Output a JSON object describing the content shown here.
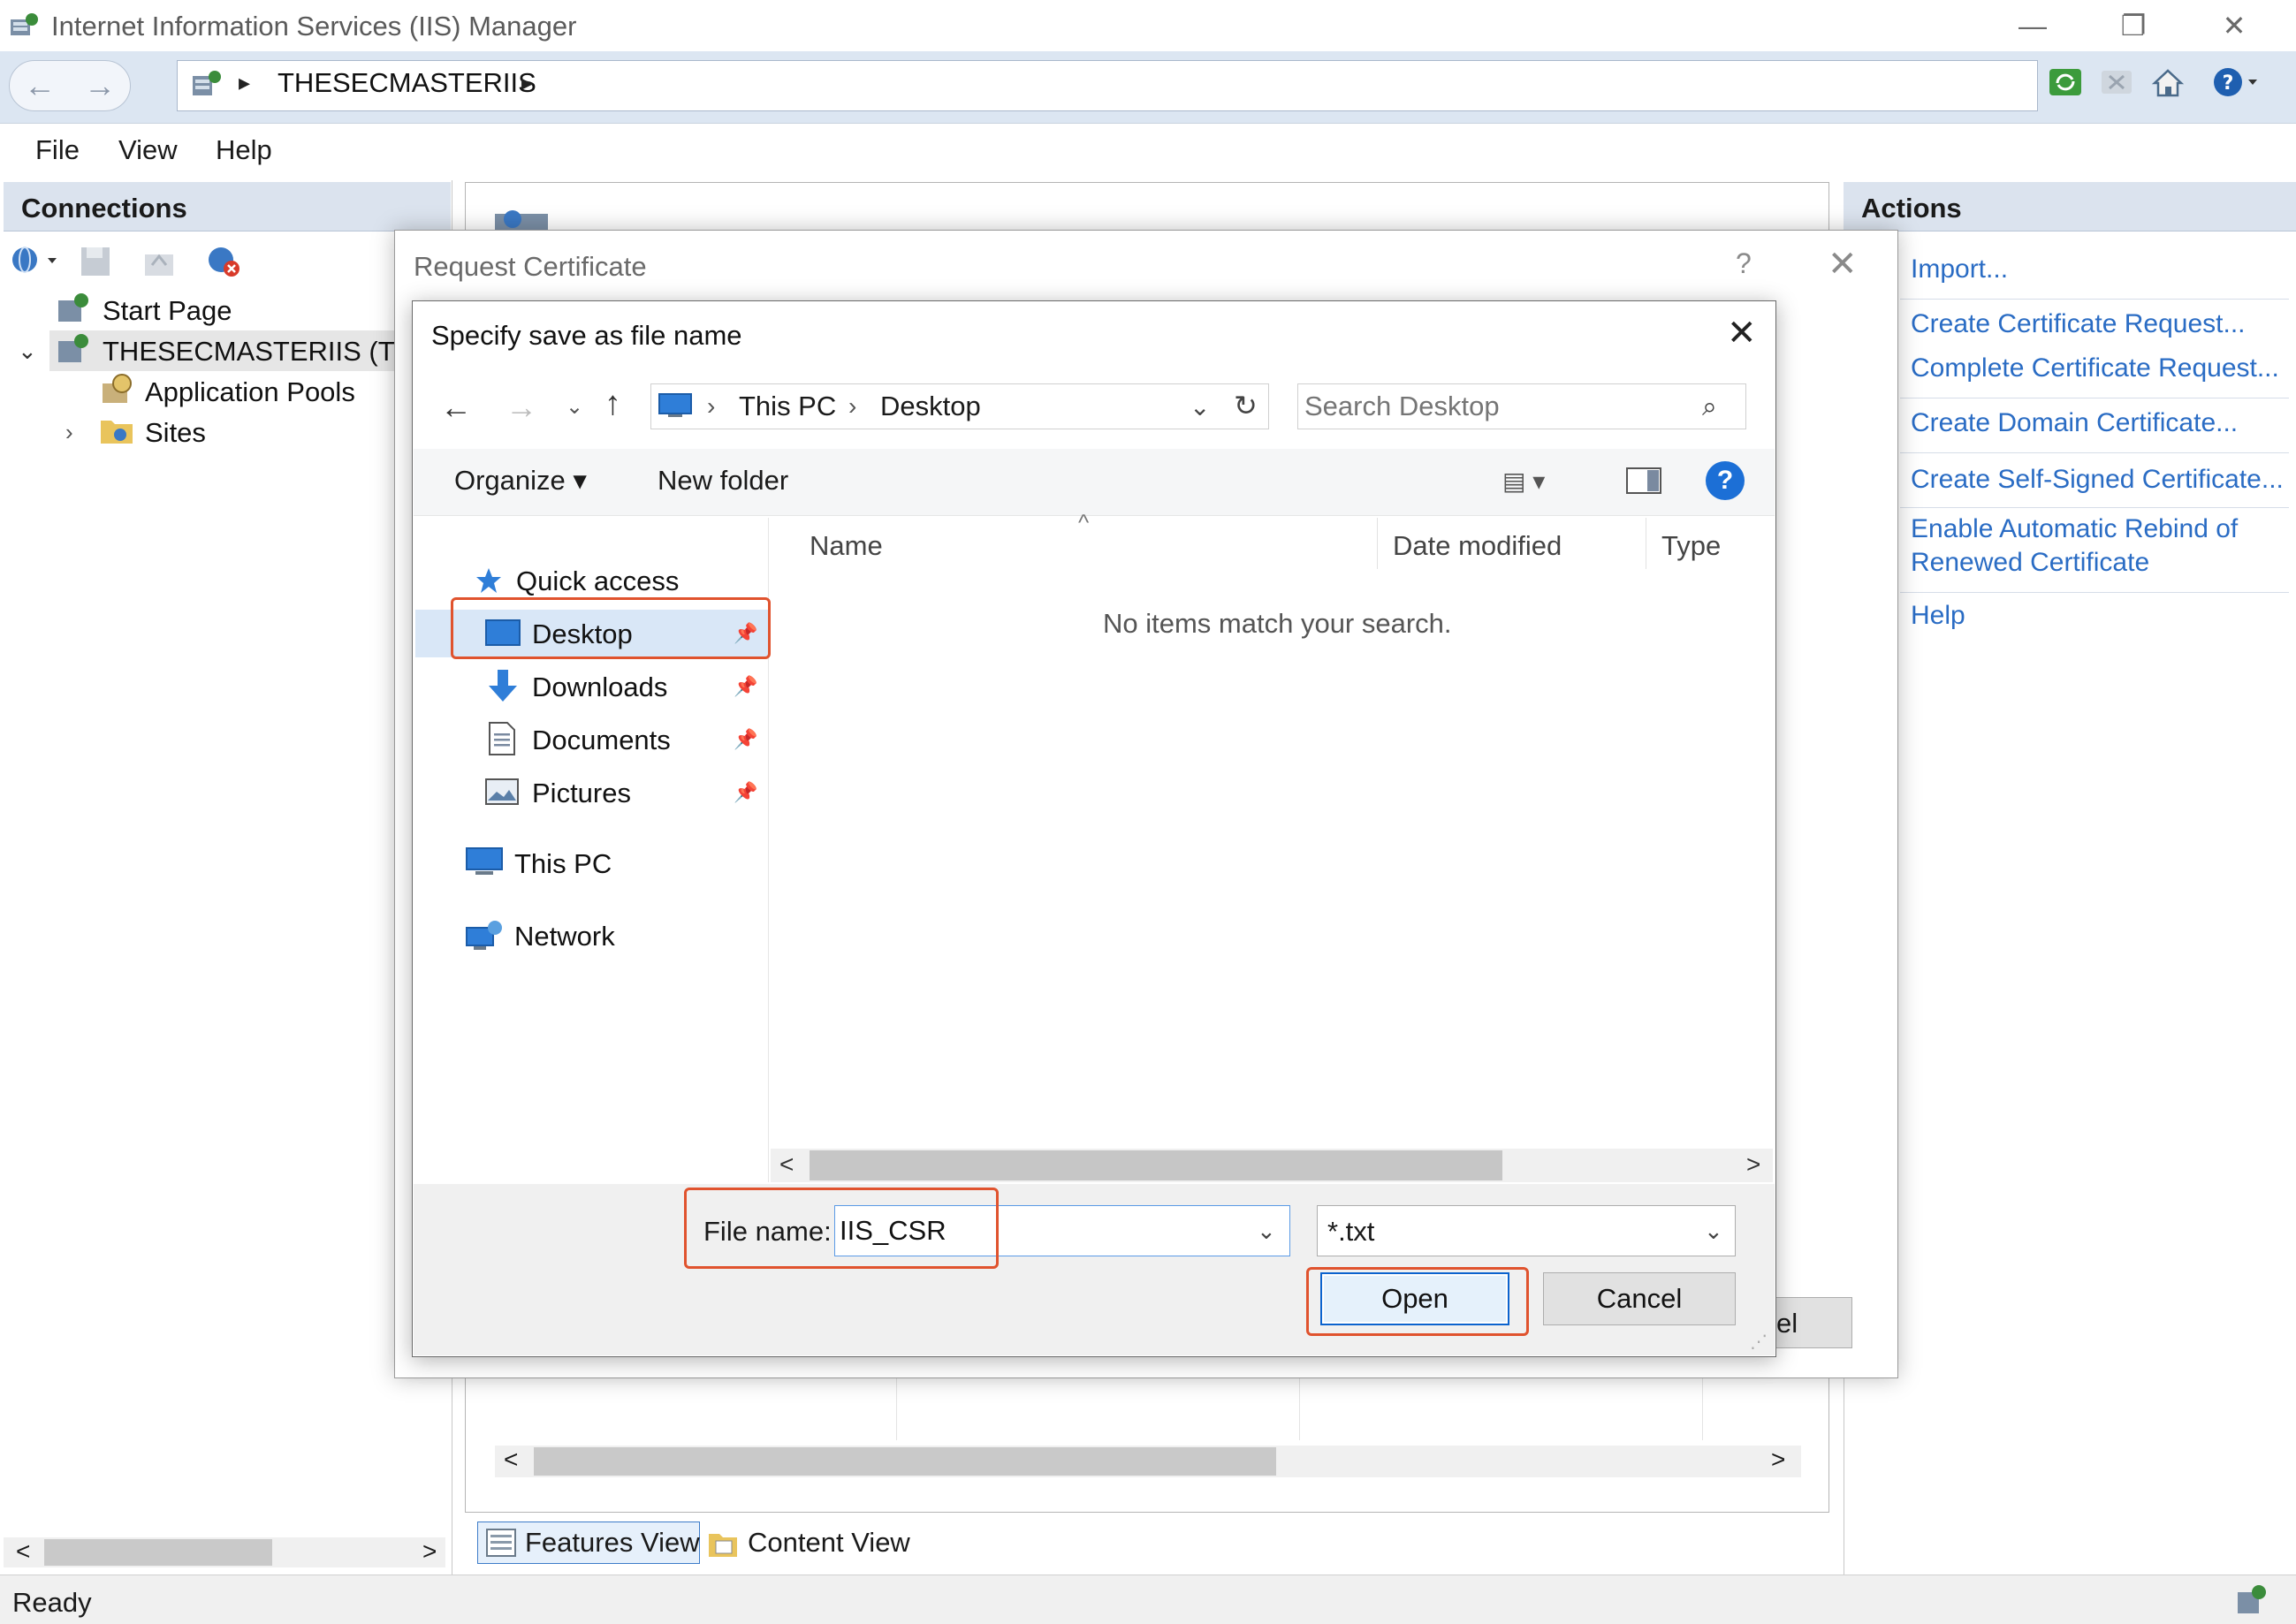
{
  "window": {
    "title": "Internet Information Services (IIS) Manager",
    "minimize": "—",
    "restore": "❐",
    "close": "✕"
  },
  "address": {
    "back": "←",
    "forward": "→",
    "arrow": "▸",
    "node": "THESECMASTERIIS"
  },
  "menu": {
    "file": "File",
    "view": "View",
    "help": "Help"
  },
  "connections": {
    "title": "Connections",
    "tree": {
      "start_page": "Start Page",
      "server": "THESECMASTERIIS (THES",
      "app_pools": "Application Pools",
      "sites": "Sites"
    },
    "scroll_left": "<",
    "scroll_right": ">"
  },
  "center": {
    "features_view": "Features View",
    "content_view": "Content View",
    "scroll_left": "<",
    "scroll_right": ">"
  },
  "actions": {
    "title": "Actions",
    "import": "Import...",
    "create_request": "Create Certificate Request...",
    "complete_request": "Complete Certificate Request...",
    "create_domain": "Create Domain Certificate...",
    "create_self_signed": "Create Self-Signed Certificate...",
    "enable_rebind_line1": "Enable Automatic Rebind of",
    "enable_rebind_line2": "Renewed Certificate",
    "help": "Help"
  },
  "status": {
    "text": "Ready"
  },
  "request_dialog": {
    "title": "Request Certificate",
    "help": "?",
    "close": "✕",
    "cancel_partial": "el"
  },
  "save_dialog": {
    "title": "Specify save as file name",
    "close": "✕",
    "nav": {
      "back": "←",
      "forward": "→",
      "recent": "⌄",
      "up": "↑"
    },
    "path": {
      "separator": "›",
      "this_pc": "This PC",
      "desktop": "Desktop",
      "dropdown": "⌄",
      "refresh": "↻"
    },
    "search": {
      "placeholder": "Search Desktop"
    },
    "toolbar": {
      "organize": "Organize ▾",
      "new_folder": "New folder",
      "view": "▤ ▾",
      "help": "?"
    },
    "nav_pane": {
      "quick_access": "Quick access",
      "desktop": "Desktop",
      "downloads": "Downloads",
      "documents": "Documents",
      "pictures": "Pictures",
      "this_pc": "This PC",
      "network": "Network",
      "pin": "📌"
    },
    "columns": {
      "name": "Name",
      "date_modified": "Date modified",
      "type": "Type",
      "sort_caret": "^"
    },
    "empty_message": "No items match your search.",
    "scroll_left": "<",
    "scroll_right": ">",
    "filename_label": "File name:",
    "filename_value": "IIS_CSR",
    "filetype_value": "*.txt",
    "open_label": "Open",
    "cancel_label": "Cancel"
  },
  "colors": {
    "link": "#2a6cc4",
    "highlight": "#e0532e",
    "accent": "#0b63ce"
  }
}
